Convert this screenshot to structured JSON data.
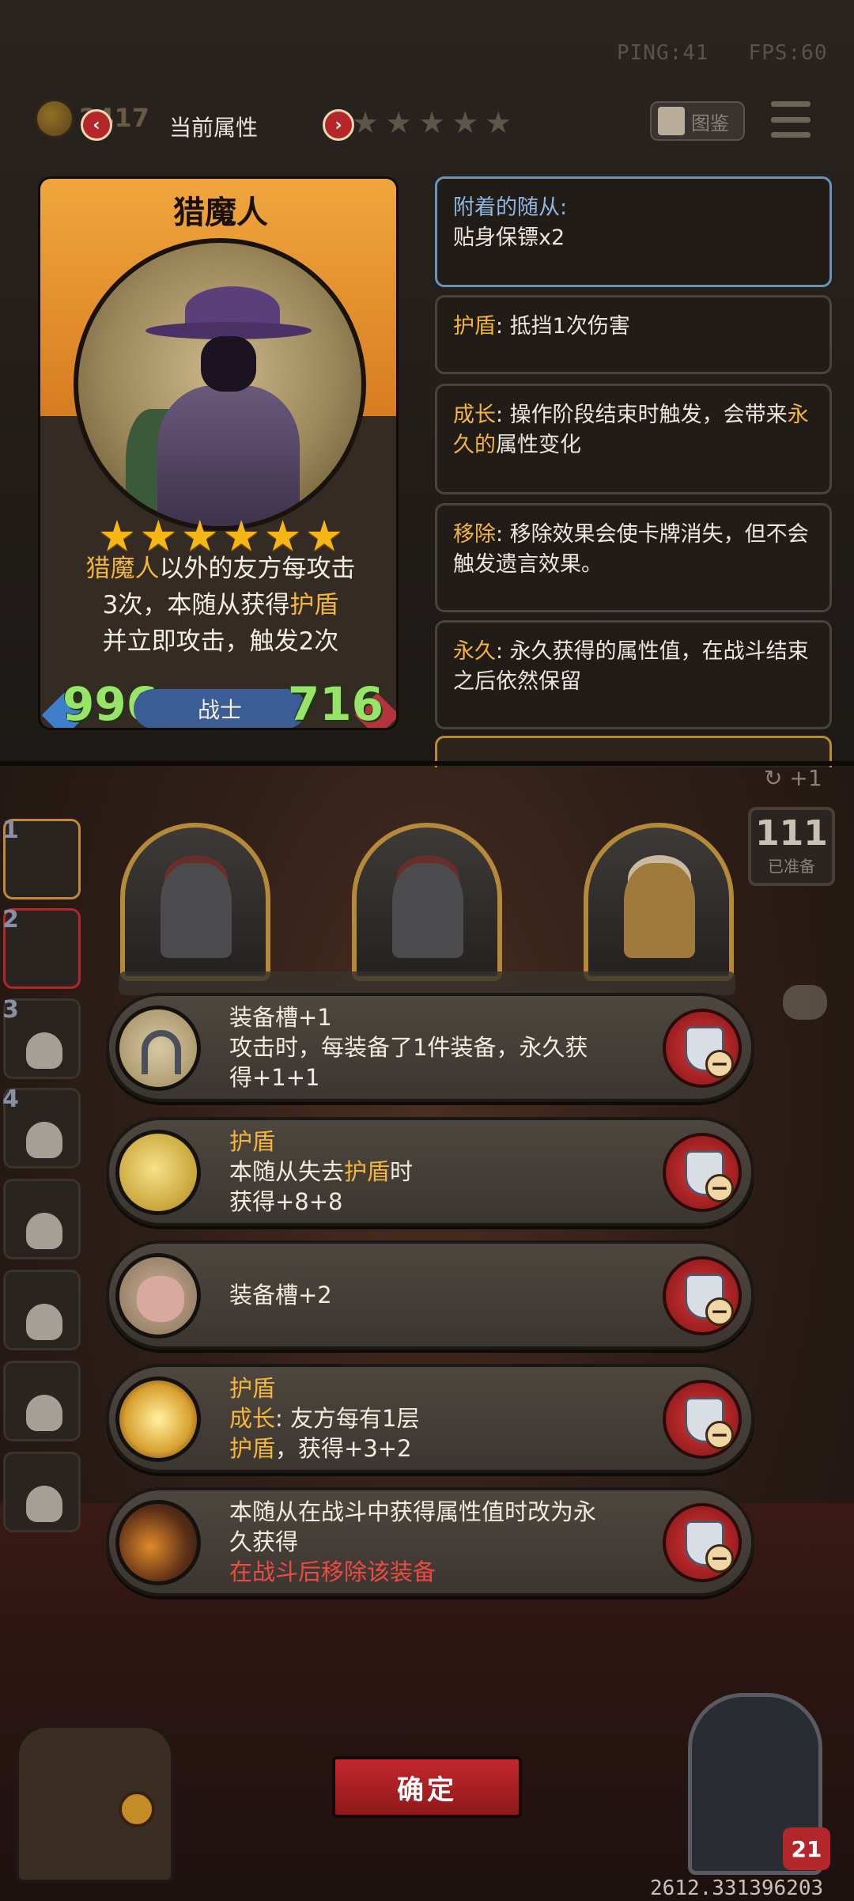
{
  "status": {
    "ping": "PING:41",
    "fps": "FPS:60",
    "gold": "2417"
  },
  "header": {
    "title": "当前属性",
    "stars": "★★★★★",
    "tujian_label": "图鉴"
  },
  "card": {
    "name": "猎魔人",
    "stars": "★★★★★★",
    "desc_line1_pre": "猎魔人",
    "desc_line1_post": "以外的友方每攻击",
    "desc_line2_pre": "3次，本随从获得",
    "desc_line2_key": "护盾",
    "desc_line3": "并立即攻击，触发2次",
    "attack": "996",
    "health": "716",
    "class": "战士"
  },
  "keywords": [
    {
      "title": "附着的随从:",
      "body": "贴身保镖x2"
    },
    {
      "key": "护盾",
      "body": ": 抵挡1次伤害"
    },
    {
      "key": "成长",
      "body": ": 操作阶段结束时触发，会带来",
      "key2": "永久的",
      "body2": "属性变化"
    },
    {
      "key": "移除",
      "body": ": 移除效果会使卡牌消失，但不会触发遗言效果。"
    },
    {
      "key": "永久",
      "body": ": 永久获得的属性值，在战斗结束之后依然保留"
    }
  ],
  "board": {
    "refresh": "↻ +1",
    "deck_count": "111",
    "deck_label": "已准备",
    "side_slots": [
      "1",
      "2",
      "3",
      "4"
    ]
  },
  "equipment": [
    {
      "line1": "装备槽+1",
      "line2": "攻击时，每装备了1件装备，永久获",
      "line3": "得+1+1",
      "icon": "horseshoe-icon"
    },
    {
      "key": "护盾",
      "line2_pre": "本随从失去",
      "line2_key": "护盾",
      "line2_post": "时",
      "line3": "获得+8+8",
      "icon": "moon-icon"
    },
    {
      "line1": "装备槽+2",
      "icon": "pig-icon"
    },
    {
      "key": "护盾",
      "key2": "成长",
      "line2_post": ": 友方每有1层",
      "key3": "护盾",
      "line3_post": "，获得+3+2",
      "icon": "light-icon"
    },
    {
      "line1": "本随从在战斗中获得属性值时改为永",
      "line2": "久获得",
      "red": "在战斗后移除该装备",
      "icon": "fire-icon"
    }
  ],
  "footer": {
    "confirm_label": "确定",
    "lives": "21",
    "coordinate": "2612.331396203"
  },
  "colors": {
    "accent_gold": "#f3b53e",
    "confirm_red": "#c2282c",
    "stat_green": "#98e36a",
    "warning_red": "#ee4a44"
  }
}
